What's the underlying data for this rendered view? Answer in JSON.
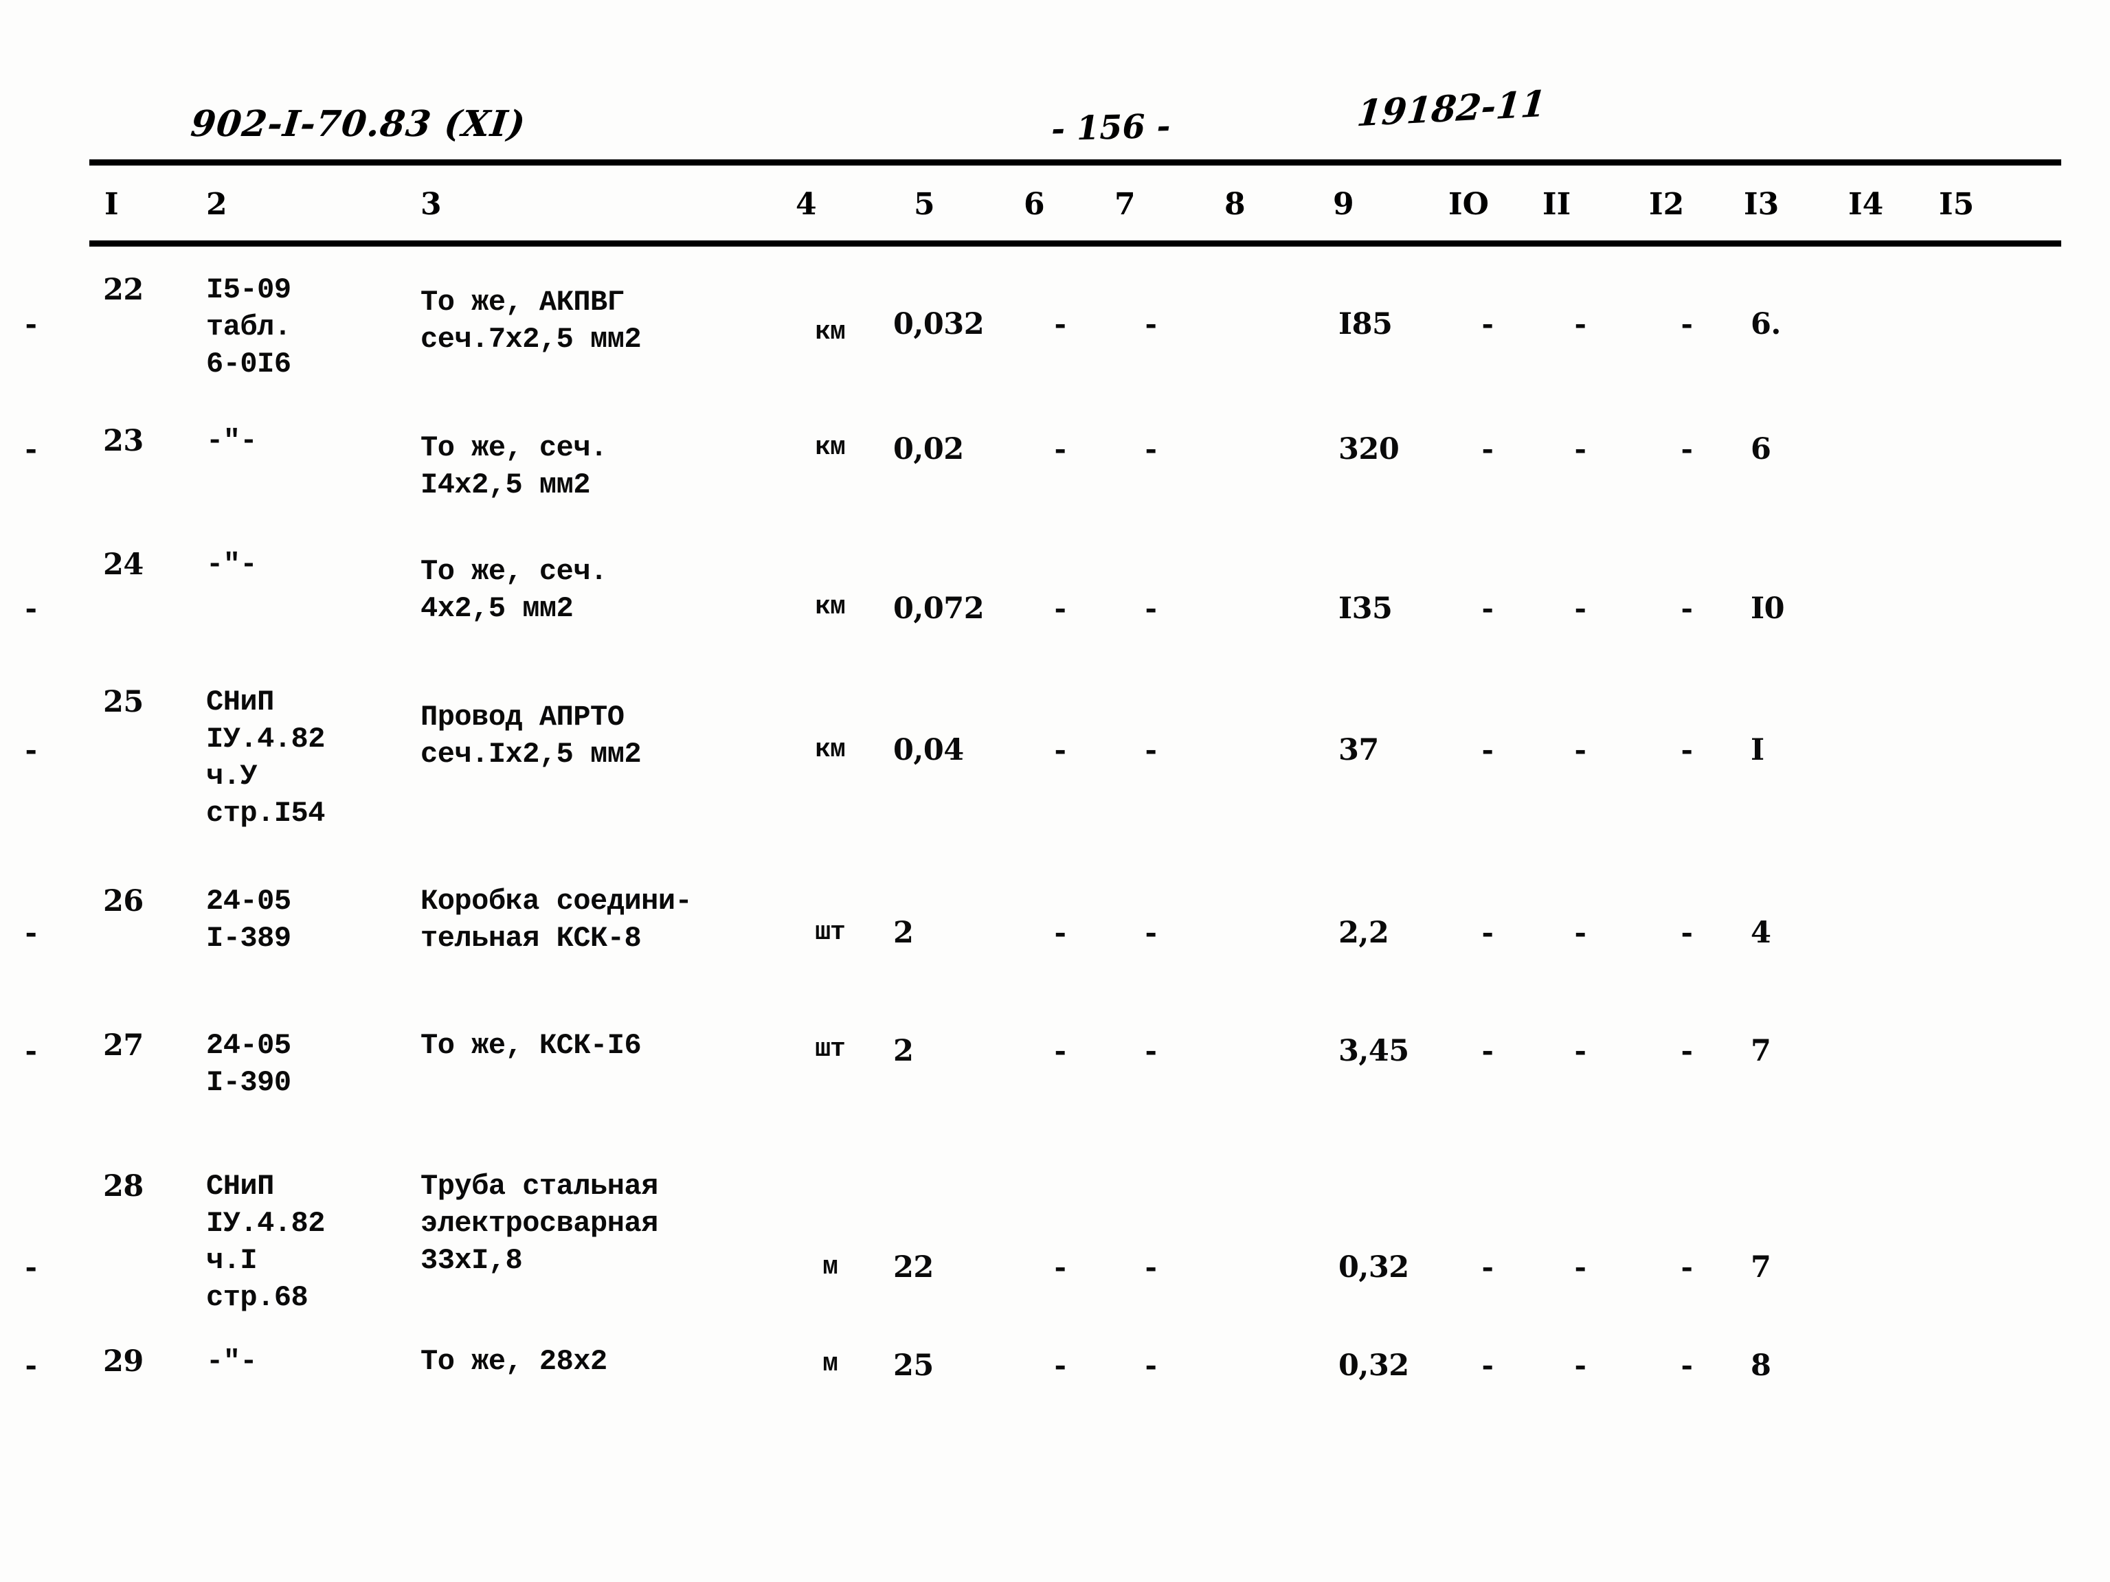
{
  "header": {
    "doc_code": "902-I-70.83  (XI)",
    "page_number": "- 156 -",
    "doc_serial": "19182-11"
  },
  "table": {
    "column_headers": [
      "I",
      "2",
      "3",
      "4",
      "5",
      "6",
      "7",
      "8",
      "9",
      "IO",
      "II",
      "I2",
      "I3",
      "I4",
      "I5"
    ],
    "rows": [
      {
        "c1": "22",
        "c2": "I5-09\nтабл.\n6-0I6",
        "c3": "То же, АКПВГ\nсеч.7х2,5 мм2",
        "c4": "км",
        "c5": "0,032",
        "c6": "-",
        "c7": "-",
        "c8": "-",
        "c9": "I85",
        "c10": "-",
        "c11": "-",
        "c12": "-",
        "c13": "6.",
        "c14": "",
        "c15": ""
      },
      {
        "c1": "23",
        "c2": "-\"-",
        "c3": "То же, сеч.\nI4х2,5 мм2",
        "c4": "км",
        "c5": "0,02",
        "c6": "-",
        "c7": "-",
        "c8": "-",
        "c9": "320",
        "c10": "-",
        "c11": "-",
        "c12": "-",
        "c13": "6",
        "c14": "",
        "c15": ""
      },
      {
        "c1": "24",
        "c2": "-\"-",
        "c3": "То же, сеч.\n4х2,5 мм2",
        "c4": "км",
        "c5": "0,072",
        "c6": "-",
        "c7": "-",
        "c8": "-",
        "c9": "I35",
        "c10": "-",
        "c11": "-",
        "c12": "-",
        "c13": "I0",
        "c14": "",
        "c15": ""
      },
      {
        "c1": "25",
        "c2": "СНиП\nIУ.4.82\nч.У\nстр.I54",
        "c3": "Провод АПРТО\nсеч.Iх2,5 мм2",
        "c4": "км",
        "c5": "0,04",
        "c6": "-",
        "c7": "-",
        "c8": "-",
        "c9": "37",
        "c10": "-",
        "c11": "-",
        "c12": "-",
        "c13": "I",
        "c14": "",
        "c15": ""
      },
      {
        "c1": "26",
        "c2": "24-05\nI-389",
        "c3": "Коробка соедини-\nтельная КСК-8",
        "c4": "шт",
        "c5": "2",
        "c6": "-",
        "c7": "-",
        "c8": "-",
        "c9": "2,2",
        "c10": "-",
        "c11": "-",
        "c12": "-",
        "c13": "4",
        "c14": "",
        "c15": ""
      },
      {
        "c1": "27",
        "c2": "24-05\nI-390",
        "c3": "То же, КСК-I6",
        "c4": "шт",
        "c5": "2",
        "c6": "-",
        "c7": "-",
        "c8": "-",
        "c9": "3,45",
        "c10": "-",
        "c11": "-",
        "c12": "-",
        "c13": "7",
        "c14": "",
        "c15": ""
      },
      {
        "c1": "28",
        "c2": "СНиП\nIУ.4.82\nч.I\nстр.68",
        "c3": "Труба стальная\nэлектросварная\n33хI,8",
        "c4": "м",
        "c5": "22",
        "c6": "-",
        "c7": "-",
        "c8": "-",
        "c9": "0,32",
        "c10": "-",
        "c11": "-",
        "c12": "-",
        "c13": "7",
        "c14": "",
        "c15": ""
      },
      {
        "c1": "29",
        "c2": "-\"-",
        "c3": "То же, 28х2",
        "c4": "м",
        "c5": "25",
        "c6": "-",
        "c7": "-",
        "c8": "-",
        "c9": "0,32",
        "c10": "-",
        "c11": "-",
        "c12": "-",
        "c13": "8",
        "c14": "",
        "c15": ""
      }
    ]
  }
}
